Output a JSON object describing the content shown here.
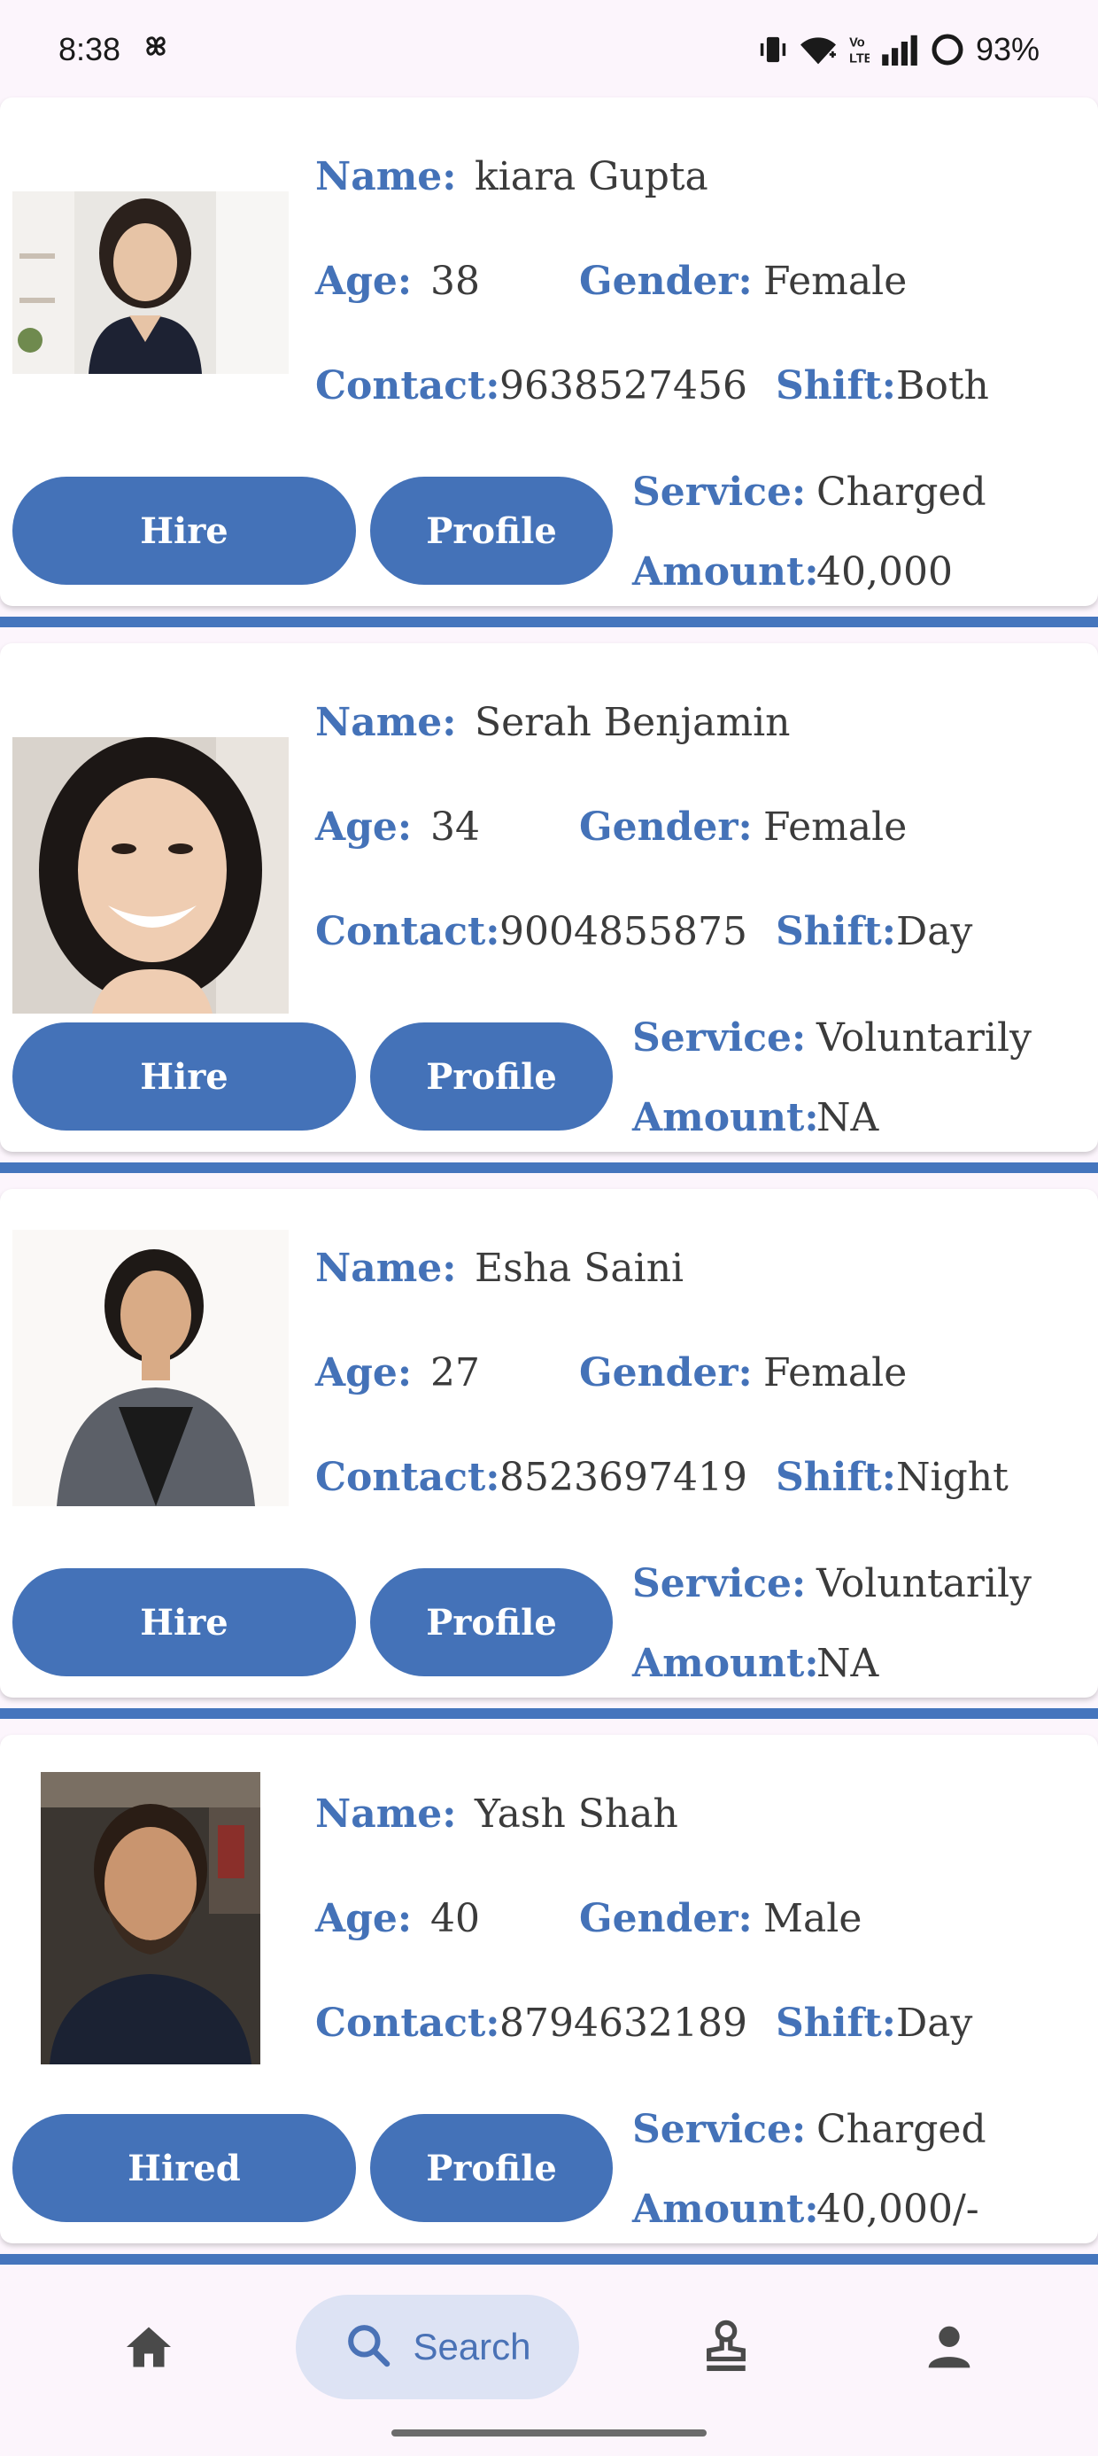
{
  "status_bar": {
    "time": "8:38",
    "battery": "93%",
    "icons": [
      "pinwheel-icon",
      "vibrate-icon",
      "wifi-icon",
      "volte-icon",
      "signal-icon",
      "battery-ring-icon"
    ]
  },
  "labels": {
    "name": "Name:",
    "age": "Age:",
    "gender": "Gender:",
    "contact": "Contact:",
    "shift": "Shift:",
    "service": "Service:",
    "amount": "Amount:"
  },
  "caregivers": [
    {
      "name": "kiara Gupta",
      "age": "38",
      "gender": "Female",
      "contact": "9638527456",
      "shift": "Both",
      "service": "Charged",
      "amount": "40,000",
      "hire_label": "Hire",
      "profile_label": "Profile"
    },
    {
      "name": "Serah Benjamin",
      "age": "34",
      "gender": "Female",
      "contact": "9004855875",
      "shift": "Day",
      "service": "Voluntarily",
      "amount": "NA",
      "hire_label": "Hire",
      "profile_label": "Profile"
    },
    {
      "name": "Esha Saini",
      "age": "27",
      "gender": "Female",
      "contact": "8523697419",
      "shift": "Night",
      "service": "Voluntarily",
      "amount": "NA",
      "hire_label": "Hire",
      "profile_label": "Profile"
    },
    {
      "name": "Yash Shah",
      "age": "40",
      "gender": "Male",
      "contact": "8794632189",
      "shift": "Day",
      "service": "Charged",
      "amount": "40,000/-",
      "hire_label": "Hired",
      "profile_label": "Profile"
    }
  ],
  "bottom_nav": {
    "items": [
      {
        "icon": "home-icon",
        "label": ""
      },
      {
        "icon": "search-icon",
        "label": "Search"
      },
      {
        "icon": "stamp-icon",
        "label": ""
      },
      {
        "icon": "person-icon",
        "label": ""
      }
    ],
    "active_index": 1
  },
  "colors": {
    "accent": "#4472b8",
    "divider": "#4575bd",
    "background": "#fcf5fc",
    "card": "#ffffff",
    "active_nav_pill": "#dde3f4"
  }
}
